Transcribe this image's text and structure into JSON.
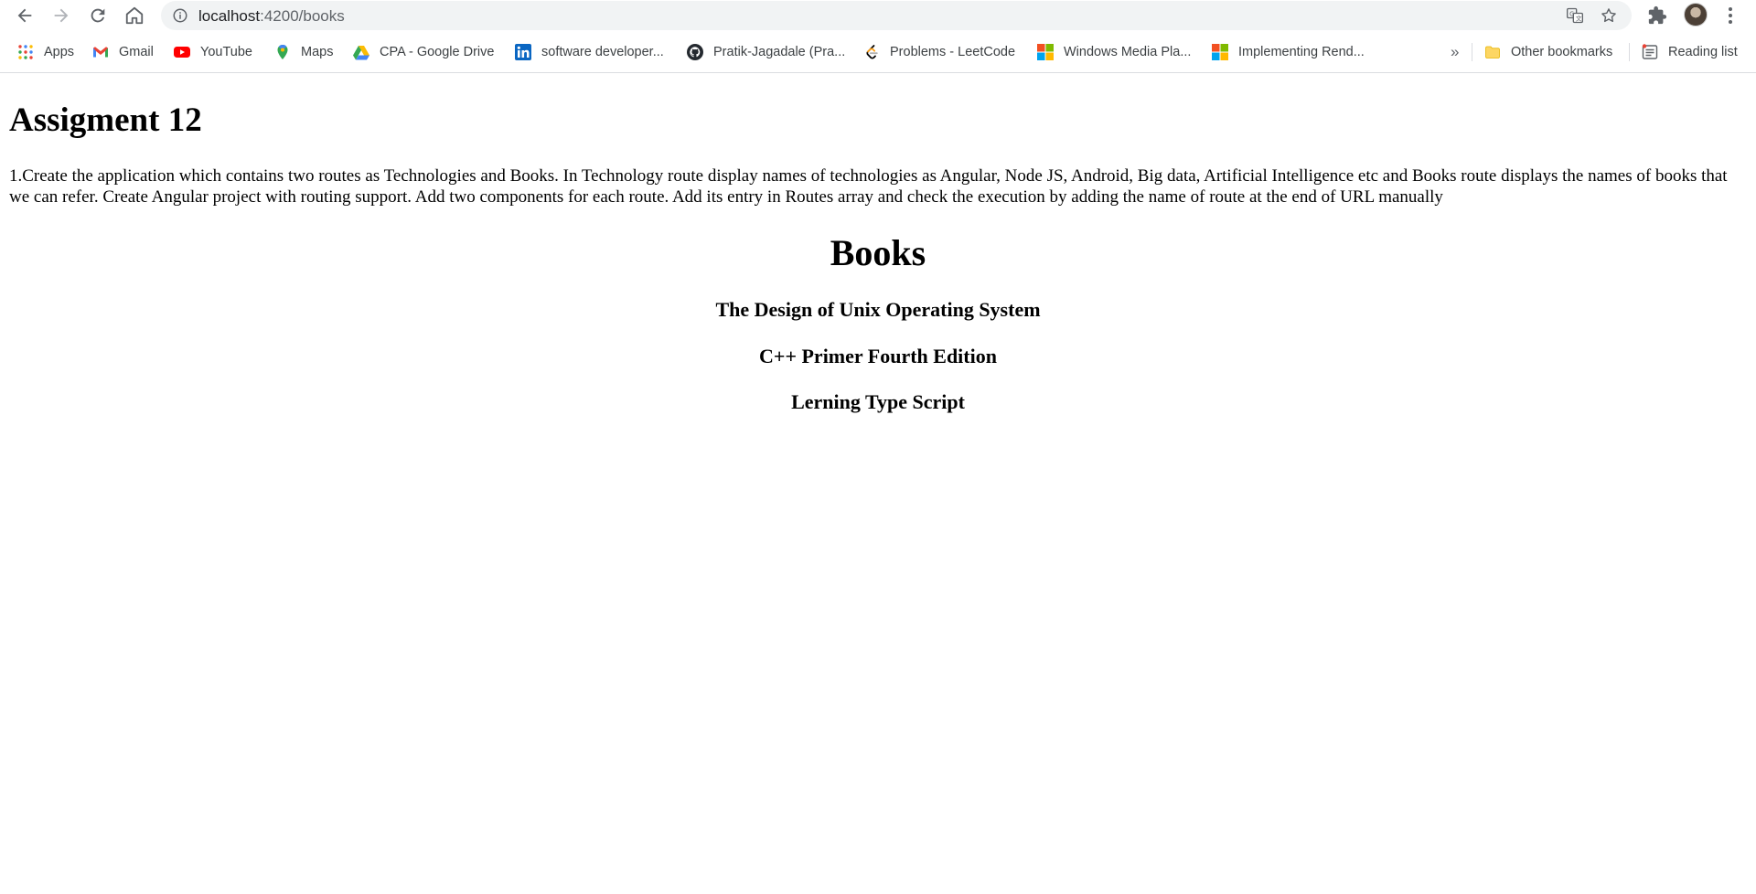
{
  "browser": {
    "url_host": "localhost",
    "url_path": ":4200/books"
  },
  "bookmarks": [
    {
      "label": "Apps",
      "icon": "apps-grid-icon"
    },
    {
      "label": "Gmail",
      "icon": "gmail-icon"
    },
    {
      "label": "YouTube",
      "icon": "youtube-icon"
    },
    {
      "label": "Maps",
      "icon": "maps-pin-icon"
    },
    {
      "label": "CPA - Google Drive",
      "icon": "google-drive-icon"
    },
    {
      "label": "software developer...",
      "icon": "linkedin-icon"
    },
    {
      "label": "Pratik-Jagadale (Pra...",
      "icon": "github-icon"
    },
    {
      "label": "Problems - LeetCode",
      "icon": "leetcode-icon"
    },
    {
      "label": "Windows Media Pla...",
      "icon": "microsoft-icon"
    },
    {
      "label": "Implementing Rend...",
      "icon": "microsoft-icon"
    }
  ],
  "bookmarks_more": "»",
  "other_bookmarks": "Other bookmarks",
  "reading_list": "Reading list",
  "page": {
    "heading": "Assigment 12",
    "assignment_text": "1.Create the application which contains two routes as Technologies and Books. In Technology route display names of technologies as Angular, Node JS, Android, Big data, Artificial Intelligence etc and Books route displays the names of books that we can refer. Create Angular project with routing support. Add two components for each route. Add its entry in Routes array and check the execution by adding the name of route at the end of URL manually",
    "books_title": "Books",
    "books": [
      "The Design of Unix Operating System",
      "C++ Primer Fourth Edition",
      "Lerning Type Script"
    ]
  }
}
